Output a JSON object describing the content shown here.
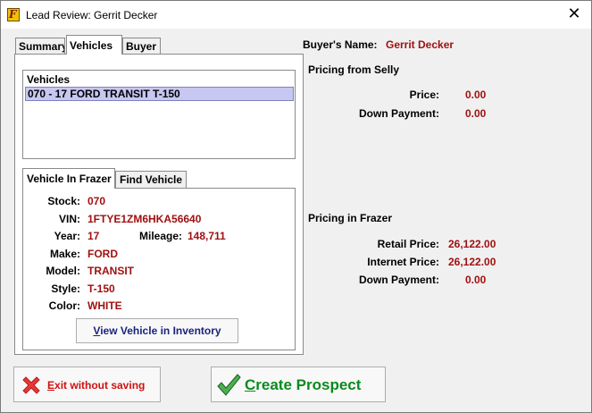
{
  "window": {
    "title": "Lead Review: Gerrit Decker",
    "close_glyph": "✕",
    "icon": "app-logo-icon",
    "icon_letter": "F"
  },
  "tabs": [
    {
      "label": "Summary",
      "active": false
    },
    {
      "label": "Vehicles",
      "active": true
    },
    {
      "label": "Buyer",
      "active": false
    }
  ],
  "buyer": {
    "label": "Buyer's Name:",
    "name": "Gerrit Decker"
  },
  "vehicles_list": {
    "header": "Vehicles",
    "items": [
      "070 - 17 FORD TRANSIT T-150"
    ],
    "selected_index": 0
  },
  "inner_tabs": [
    {
      "label": "Vehicle In Frazer",
      "active": true
    },
    {
      "label": "Find Vehicle",
      "active": false
    }
  ],
  "vehicle": {
    "stock_label": "Stock:",
    "stock": "070",
    "vin_label": "VIN:",
    "vin": "1FTYE1ZM6HKA56640",
    "year_label": "Year:",
    "year": "17",
    "mileage_label": "Mileage:",
    "mileage": "148,711",
    "make_label": "Make:",
    "make": "FORD",
    "model_label": "Model:",
    "model": "TRANSIT",
    "style_label": "Style:",
    "style": "T-150",
    "color_label": "Color:",
    "color": "WHITE"
  },
  "view_inventory_button": {
    "label_underlined": "V",
    "label_rest": "iew Vehicle in Inventory"
  },
  "pricing_selly": {
    "title": "Pricing from Selly",
    "price_label": "Price:",
    "price": "0.00",
    "down_label": "Down Payment:",
    "down": "0.00"
  },
  "pricing_frazer": {
    "title": "Pricing in Frazer",
    "retail_label": "Retail Price:",
    "retail": "26,122.00",
    "internet_label": "Internet Price:",
    "internet": "26,122.00",
    "down_label": "Down Payment:",
    "down": "0.00"
  },
  "exit_button": {
    "label_underlined": "E",
    "label_rest": "xit without saving",
    "icon": "red-x-icon"
  },
  "create_button": {
    "label_underlined": "C",
    "label_rest": "reate Prospect",
    "icon": "green-check-icon"
  },
  "colors": {
    "value_red": "#a01010",
    "exit_red": "#d01010",
    "create_green": "#0b8a1e",
    "selection": "#c7c7f2"
  }
}
